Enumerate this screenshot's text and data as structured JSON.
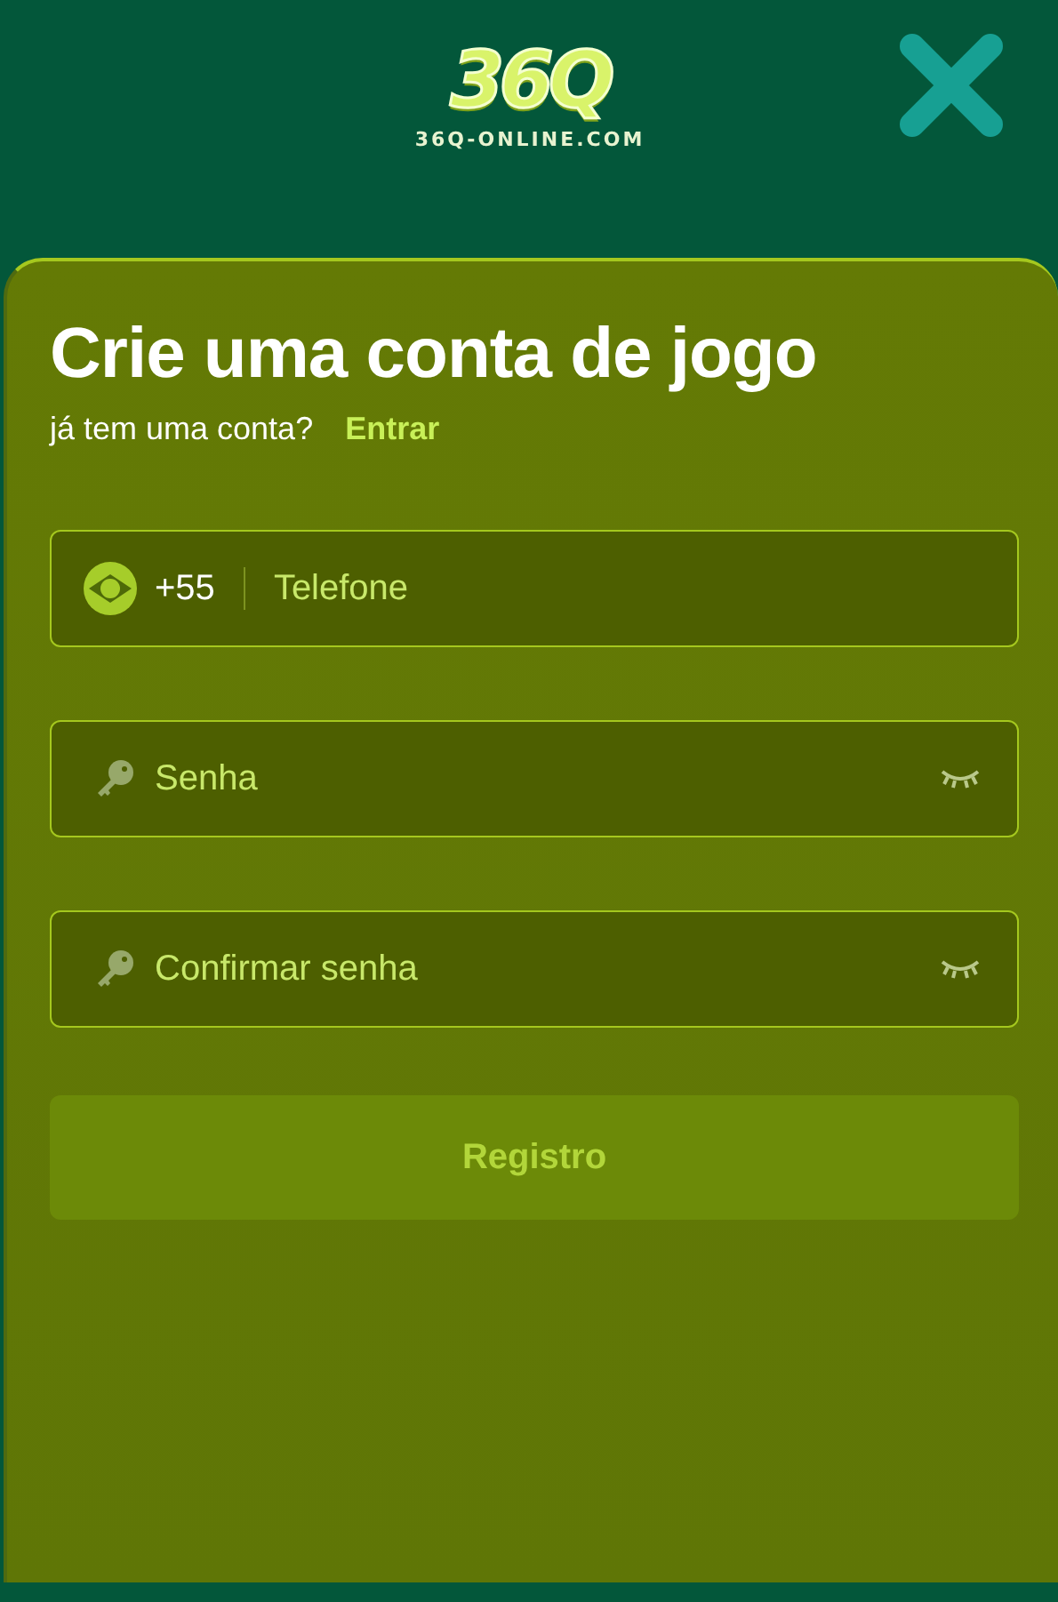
{
  "header": {
    "logo": "36Q",
    "domain": "36Q-ONLINE.COM"
  },
  "title": "Crie uma conta de jogo",
  "login_prompt": {
    "text": "já tem uma conta?",
    "link": "Entrar"
  },
  "fields": [
    {
      "kind": "phone",
      "prefix": "+55",
      "placeholder": "Telefone"
    },
    {
      "kind": "password",
      "placeholder": "Senha",
      "visible": false
    },
    {
      "kind": "password",
      "placeholder": "Confirmar senha",
      "visible": false
    }
  ],
  "submit": {
    "label": "Registro",
    "disabled": true
  }
}
